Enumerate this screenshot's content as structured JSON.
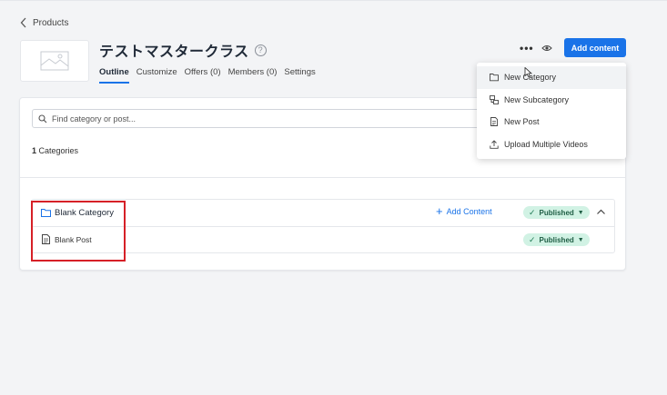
{
  "breadcrumb": {
    "back_label": "Products"
  },
  "header": {
    "title": "テストマスタークラス",
    "help_glyph": "?",
    "more_glyph": "•••",
    "add_content_label": "Add content"
  },
  "tabs": [
    {
      "label": "Outline",
      "active": true
    },
    {
      "label": "Customize"
    },
    {
      "label": "Offers (0)"
    },
    {
      "label": "Members (0)"
    },
    {
      "label": "Settings"
    }
  ],
  "content": {
    "search_placeholder": "Find category or post...",
    "count_number": "1",
    "count_label": "Categories",
    "rows": [
      {
        "label": "Blank Category",
        "add_content": "Add Content",
        "status": "Published"
      },
      {
        "label": "Blank Post",
        "status": "Published"
      }
    ]
  },
  "menu": {
    "items": [
      {
        "label": "New Category",
        "icon": "folder-icon"
      },
      {
        "label": "New Subcategory",
        "icon": "subcategory-icon"
      },
      {
        "label": "New Post",
        "icon": "document-icon"
      },
      {
        "label": "Upload Multiple Videos",
        "icon": "upload-icon"
      }
    ]
  },
  "colors": {
    "accent": "#1a73e8",
    "published_bg": "#d1f2e4",
    "highlight": "#d62027"
  }
}
